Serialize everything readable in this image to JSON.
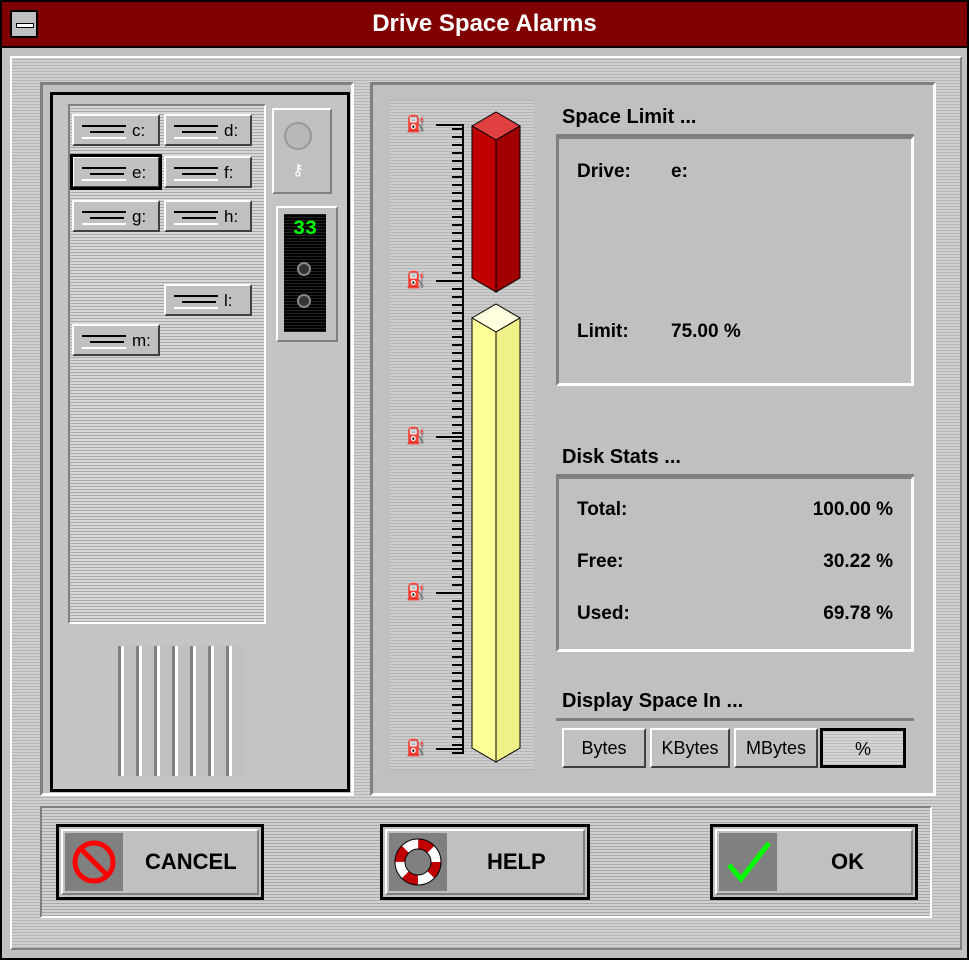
{
  "window": {
    "title": "Drive Space Alarms"
  },
  "drives": [
    {
      "label": "c:"
    },
    {
      "label": "d:"
    },
    {
      "label": "e:"
    },
    {
      "label": "f:"
    },
    {
      "label": "g:"
    },
    {
      "label": "h:"
    },
    {
      "label": "l:"
    },
    {
      "label": "m:"
    }
  ],
  "selected_drive": "e:",
  "meter": {
    "value": "33"
  },
  "space_limit": {
    "header": "Space Limit ...",
    "drive_label": "Drive:",
    "drive_value": "e:",
    "limit_label": "Limit:",
    "limit_value": "75.00 %"
  },
  "disk_stats": {
    "header": "Disk Stats ...",
    "total_label": "Total:",
    "total_value": "100.00 %",
    "free_label": "Free:",
    "free_value": "30.22 %",
    "used_label": "Used:",
    "used_value": "69.78 %"
  },
  "gauge": {
    "limit_fraction": 0.75,
    "used_fraction": 0.6978
  },
  "display_space": {
    "header": "Display Space In ...",
    "options": [
      "Bytes",
      "KBytes",
      "MBytes",
      "%"
    ],
    "selected": "%"
  },
  "buttons": {
    "cancel": "CANCEL",
    "help": "HELP",
    "ok": "OK"
  },
  "colors": {
    "title_bar": "#800000",
    "limit_red": "#c00000",
    "used_yellow": "#ffff99",
    "meter_green": "#00ff00"
  }
}
